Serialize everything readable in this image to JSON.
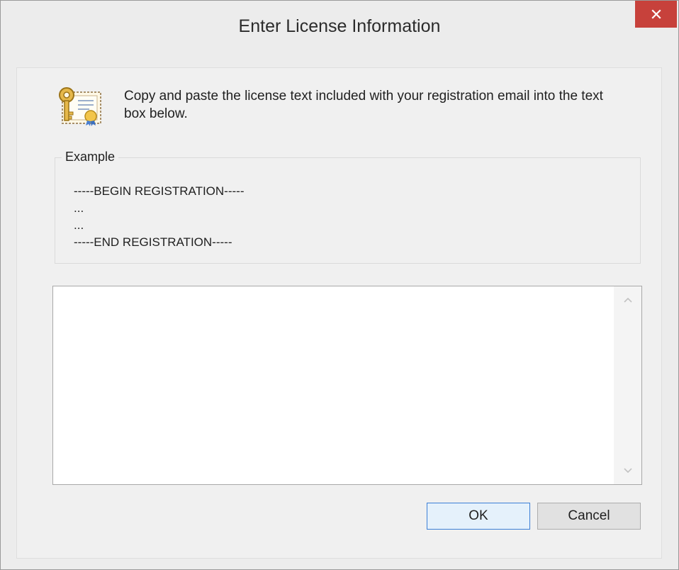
{
  "window": {
    "title": "Enter License Information"
  },
  "instruction": {
    "text": "Copy and paste the license text included with your registration email into the text box below."
  },
  "example": {
    "legend": "Example",
    "lines": [
      "-----BEGIN REGISTRATION-----",
      "...",
      "...",
      "-----END REGISTRATION-----"
    ]
  },
  "license_input": {
    "value": ""
  },
  "buttons": {
    "ok_label": "OK",
    "cancel_label": "Cancel"
  },
  "icons": {
    "close": "close-icon",
    "certificate": "certificate-icon",
    "scroll_up": "chevron-up-icon",
    "scroll_down": "chevron-down-icon"
  },
  "colors": {
    "close_button": "#c7413b",
    "window_background": "#ececec",
    "default_button_border": "#3c7fd6"
  }
}
